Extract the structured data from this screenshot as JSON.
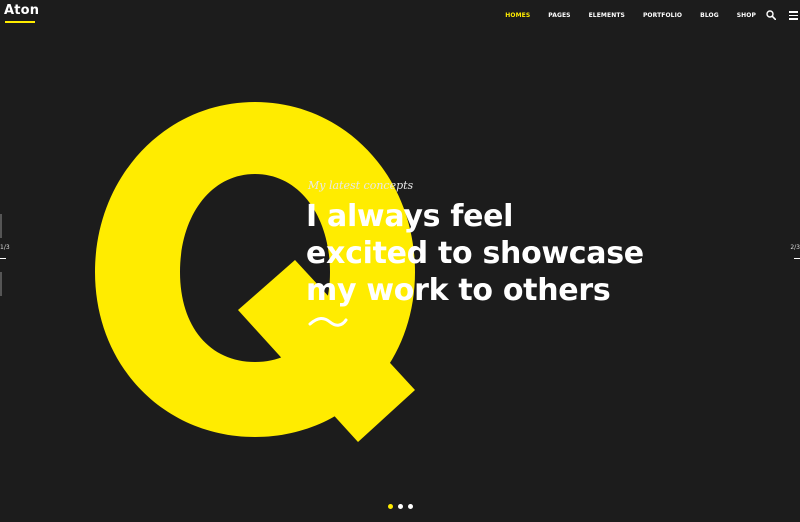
{
  "header": {
    "logo": "Aton",
    "nav": [
      {
        "label": "HOMES",
        "active": true
      },
      {
        "label": "PAGES",
        "active": false
      },
      {
        "label": "ELEMENTS",
        "active": false
      },
      {
        "label": "PORTFOLIO",
        "active": false
      },
      {
        "label": "BLOG",
        "active": false
      },
      {
        "label": "SHOP",
        "active": false
      }
    ],
    "icons": [
      "search-icon",
      "hamburger-menu-icon"
    ]
  },
  "hero": {
    "big_letter": "Q",
    "eyebrow": "My latest concepts",
    "headline_lines": [
      "I always feel",
      "excited to showcase",
      "my work to others"
    ]
  },
  "slider": {
    "counter_left": "1/3",
    "counter_right": "2/3",
    "current_slide": 1,
    "total_slides": 3
  },
  "colors": {
    "background": "#1c1c1c",
    "accent": "#ffec00",
    "text": "#ffffff"
  }
}
